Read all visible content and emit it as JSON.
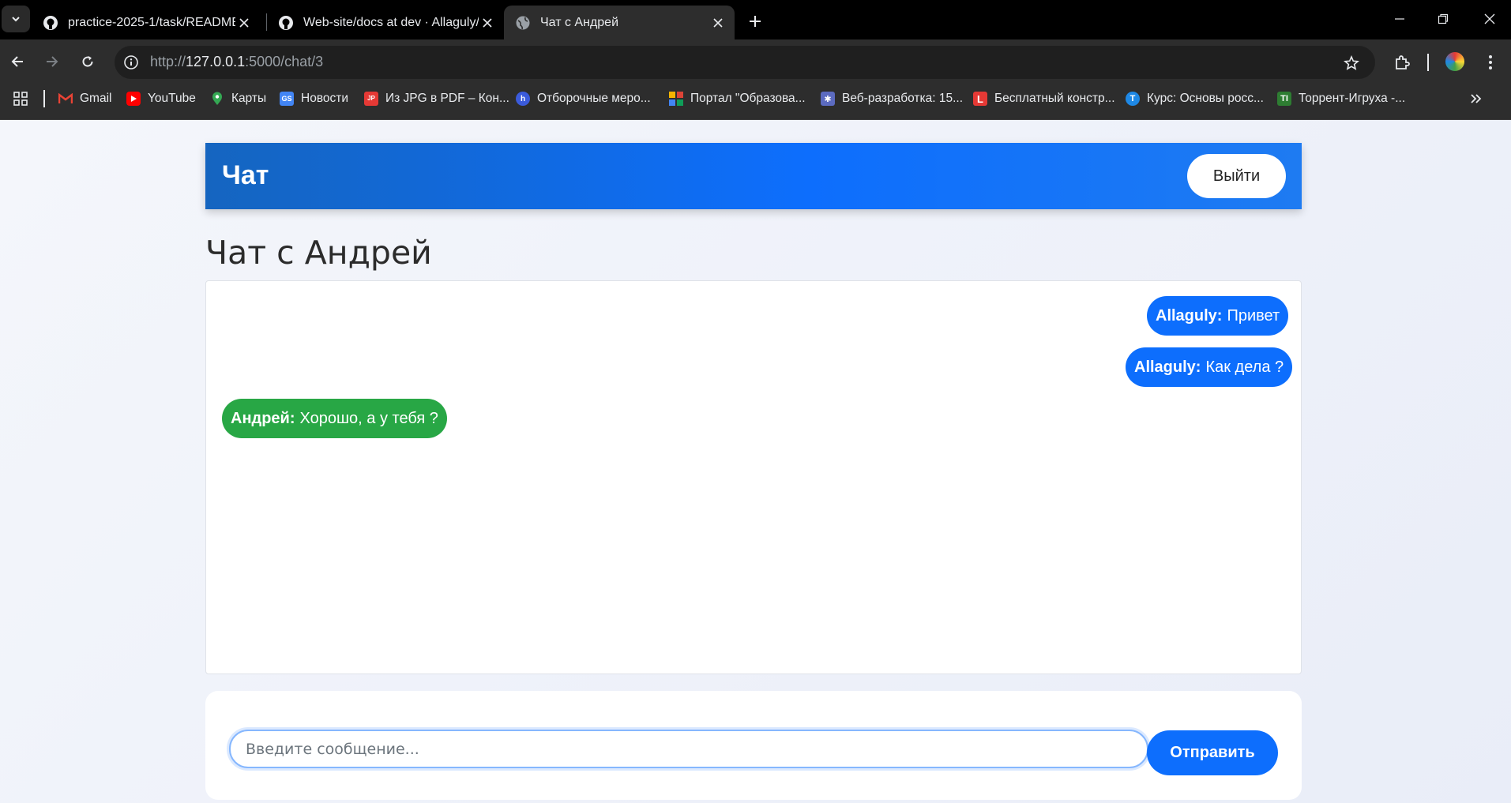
{
  "browser": {
    "tabs": [
      {
        "title": "practice-2025-1/task/README.md",
        "icon": "github-icon",
        "active": false
      },
      {
        "title": "Web-site/docs at dev · Allaguly/",
        "icon": "github-icon",
        "active": false
      },
      {
        "title": "Чат с Андрей",
        "icon": "globe-icon",
        "active": true
      }
    ],
    "url_scheme": "http://",
    "url_host": "127.0.0.1",
    "url_path": ":5000/chat/3",
    "bookmarks": [
      {
        "label": "Gmail",
        "icon": "gmail-icon",
        "color": "#ea4335"
      },
      {
        "label": "YouTube",
        "icon": "youtube-icon",
        "color": "#ff0000"
      },
      {
        "label": "Карты",
        "icon": "maps-pin-icon",
        "color": "#34a853"
      },
      {
        "label": "Новости",
        "icon": "news-icon",
        "color": "#4285f4"
      },
      {
        "label": "Из JPG в PDF – Кон...",
        "icon": "jpg-pdf-icon",
        "color": "#e53935"
      },
      {
        "label": "Отборочные меро...",
        "icon": "event-icon",
        "color": "#3b5bdb"
      },
      {
        "label": "Портал \"Образова...",
        "icon": "portal-icon",
        "color": "#f4b400"
      },
      {
        "label": "Веб-разработка: 15...",
        "icon": "web-dev-icon",
        "color": "#5c6bc0"
      },
      {
        "label": "Бесплатный констр...",
        "icon": "constructor-icon",
        "color": "#e53935"
      },
      {
        "label": "Курс: Основы росс...",
        "icon": "course-icon",
        "color": "#1e88e5"
      },
      {
        "label": "Торрент-Игруха -...",
        "icon": "torrent-icon",
        "color": "#2e7d32"
      }
    ]
  },
  "header": {
    "brand": "Чат",
    "logout_label": "Выйти"
  },
  "chat": {
    "title": "Чат с Андрей",
    "messages": [
      {
        "author": "Allaguly:",
        "text": "Привет",
        "mine": true
      },
      {
        "author": "Allaguly:",
        "text": "Как дела ?",
        "mine": true
      },
      {
        "author": "Андрей:",
        "text": "Хорошо, а у тебя ?",
        "mine": false
      }
    ]
  },
  "composer": {
    "placeholder": "Введите сообщение...",
    "send_label": "Отправить"
  },
  "colors": {
    "accent": "#0d6efd",
    "other_message": "#28a745"
  }
}
